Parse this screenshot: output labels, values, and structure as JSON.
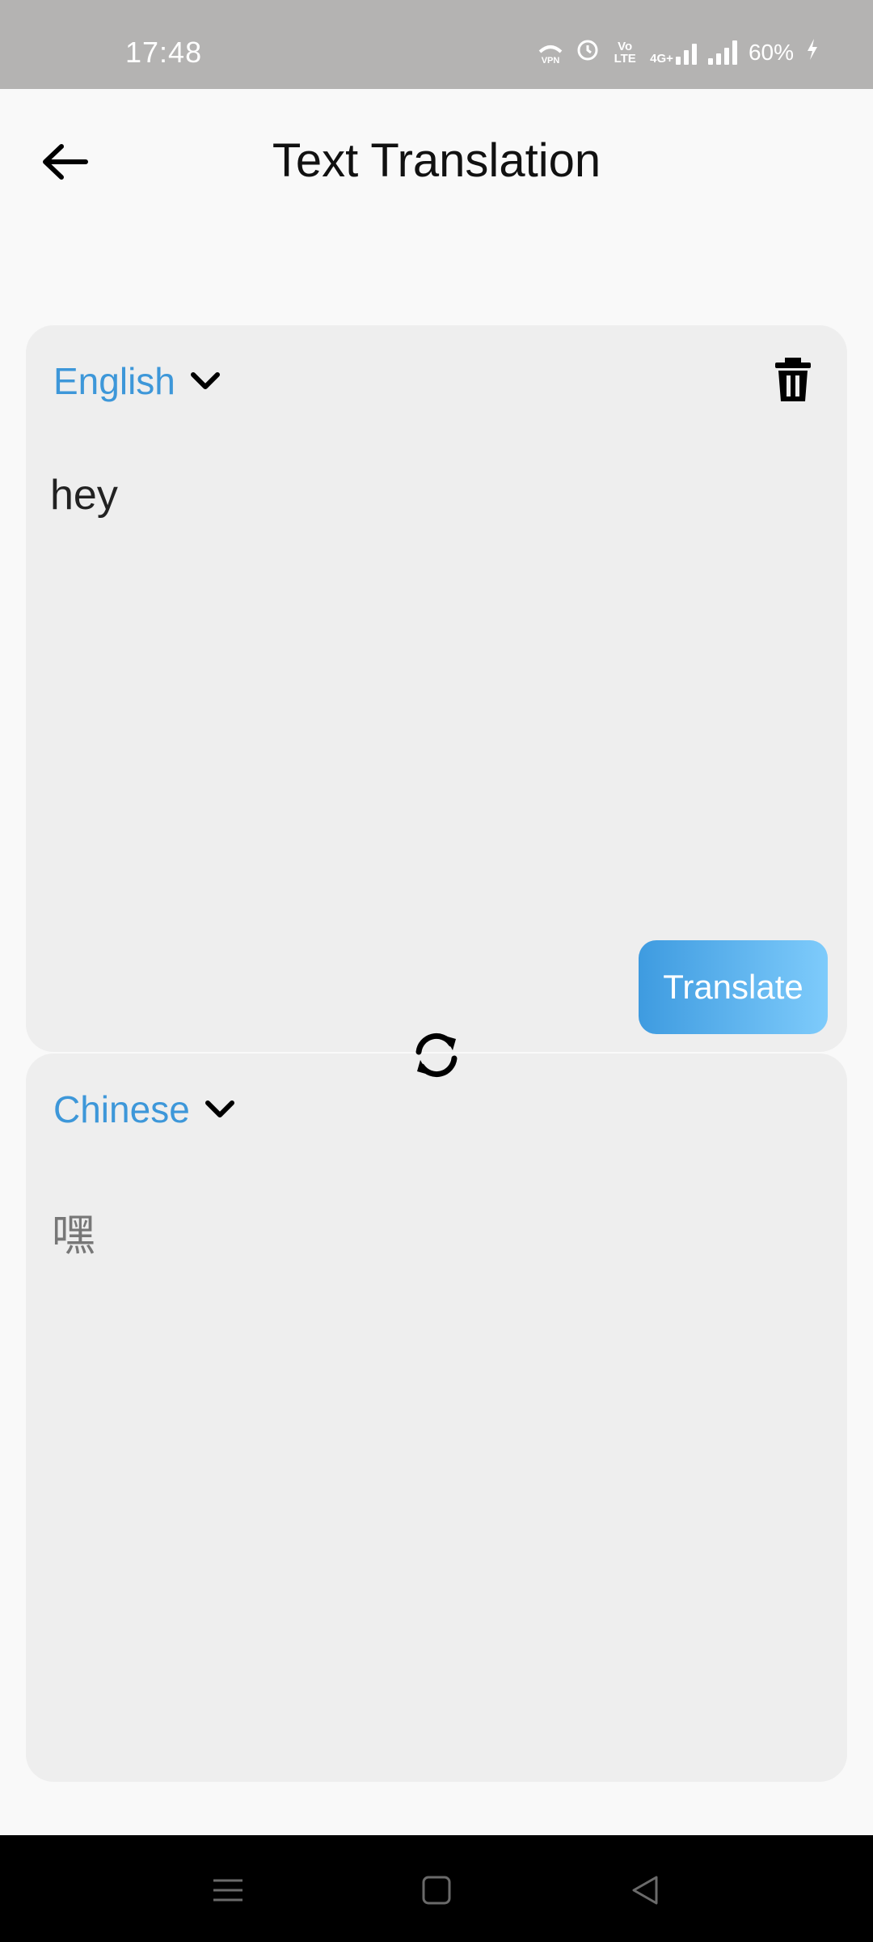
{
  "status_bar": {
    "time": "17:48",
    "vpn_label": "VPN",
    "volte_label": "Vo LTE",
    "network_label": "4G+",
    "battery": "60%"
  },
  "header": {
    "title": "Text Translation",
    "back_icon": "arrow-left-icon"
  },
  "source": {
    "language": "English",
    "text": "hey",
    "delete_icon": "trash-icon"
  },
  "translate_button": {
    "label": "Translate"
  },
  "swap_icon": "swap-icon",
  "target": {
    "language": "Chinese",
    "text": "嘿"
  },
  "colors": {
    "accent": "#3d97d9",
    "button_gradient_start": "#3e9be0",
    "button_gradient_end": "#7ecbfb",
    "card_bg": "#eeeeee",
    "status_bar_bg": "#b4b3b2"
  },
  "nav_bar": {
    "icons": [
      "menu-icon",
      "home-icon",
      "back-triangle-icon"
    ]
  }
}
